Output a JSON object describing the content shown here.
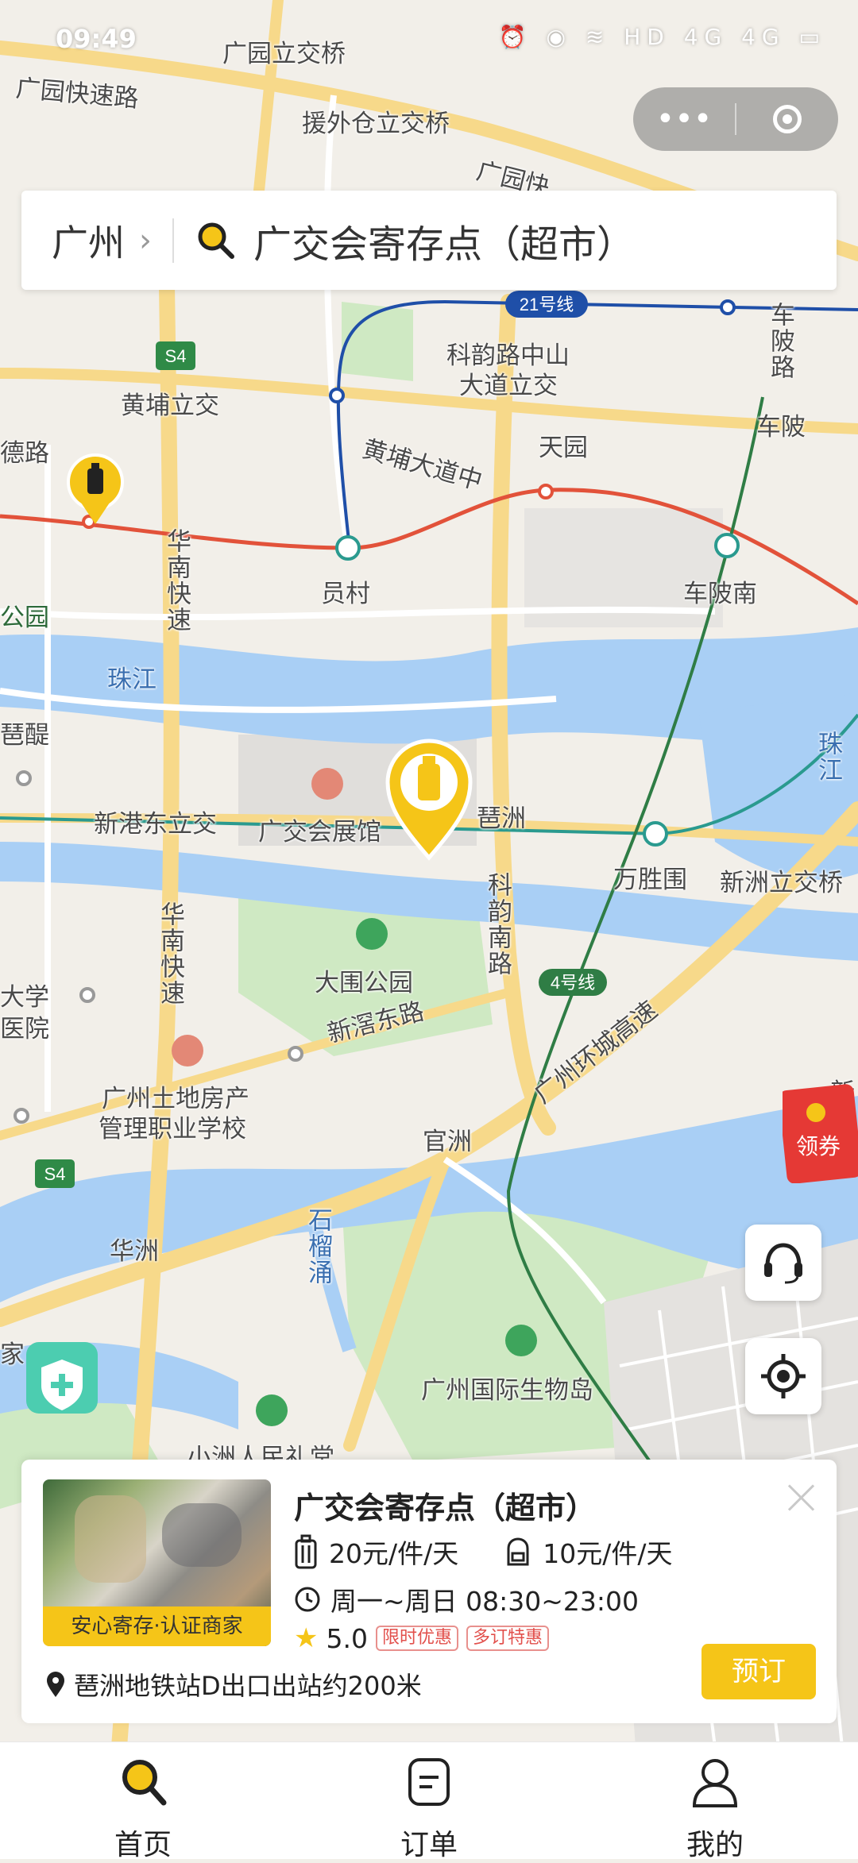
{
  "status_bar": {
    "time": "09:49",
    "indicators": "⏰ ◉ ≋ HD 4G 4G ▭"
  },
  "capsule": {
    "more_label": "•••",
    "icons": [
      "more-icon",
      "close-miniprogram-icon"
    ]
  },
  "search_bar": {
    "city": "广州",
    "query": "广交会寄存点（超市）"
  },
  "map": {
    "labels": {
      "guangyuan_bridge": "广园立交桥",
      "guangyuan_expressway": "广园快速路",
      "yuanwai_bridge": "援外仓立交桥",
      "guangyuan_road_part": "广园快",
      "line21": "21号线",
      "keyun_bridge_1": "科韵路中山",
      "keyun_bridge_2": "大道立交",
      "chepo_road": "车陂路",
      "chepo": "车陂",
      "huangpu_bridge": "黄埔立交",
      "tianyuan": "天园",
      "huangpu_avenue": "黄埔大道中",
      "de_road": "德路",
      "yuancun": "员村",
      "chebeinan": "车陂南",
      "huanan_express_1": "华南快速",
      "park": "公园",
      "zhujiang": "珠江",
      "zhujiang_2": "珠江",
      "pixing": "琶醍",
      "xingang_bridge": "新港东立交",
      "expo_hall": "广交会展馆",
      "pazhou": "琶洲",
      "wanshengwei": "万胜围",
      "xinzhou_bridge": "新洲立交桥",
      "keyun_south": "科韵南路",
      "huanan_express_2": "华南快速",
      "dawei_park": "大围公园",
      "line4": "4号线",
      "university": "大学",
      "hospital": "医院",
      "xinjiao_east": "新滘东路",
      "ring_highway": "广州环城高速",
      "land_school_1": "广州土地房产",
      "land_school_2": "管理职业学校",
      "guanzhou": "官洲",
      "s4": "S4",
      "huazhou": "华洲",
      "shiliu": "石榴涌",
      "bio_island": "广州国际生物岛",
      "home_suffix": "家",
      "xiaozhou": "小洲人民礼堂",
      "xin_edge": "新"
    }
  },
  "coupon": {
    "label": "领券"
  },
  "fab": {
    "service_icon": "headset-icon",
    "locate_icon": "locate-icon"
  },
  "card": {
    "title": "广交会寄存点（超市）",
    "badge": "安心寄存·认证商家",
    "price_large": "20元/件/天",
    "price_small": "10元/件/天",
    "hours": "周一~周日 08:30~23:00",
    "rating": "5.0",
    "tags": [
      "限时优惠",
      "多订特惠"
    ],
    "location": "琶洲地铁站D出口出站约200米",
    "book_button": "预订"
  },
  "tabbar": {
    "home": "首页",
    "orders": "订单",
    "mine": "我的"
  },
  "colors": {
    "accent": "#f5c518",
    "water": "#a9cff5",
    "green": "#cfe9c3",
    "road": "#f7d98a"
  }
}
